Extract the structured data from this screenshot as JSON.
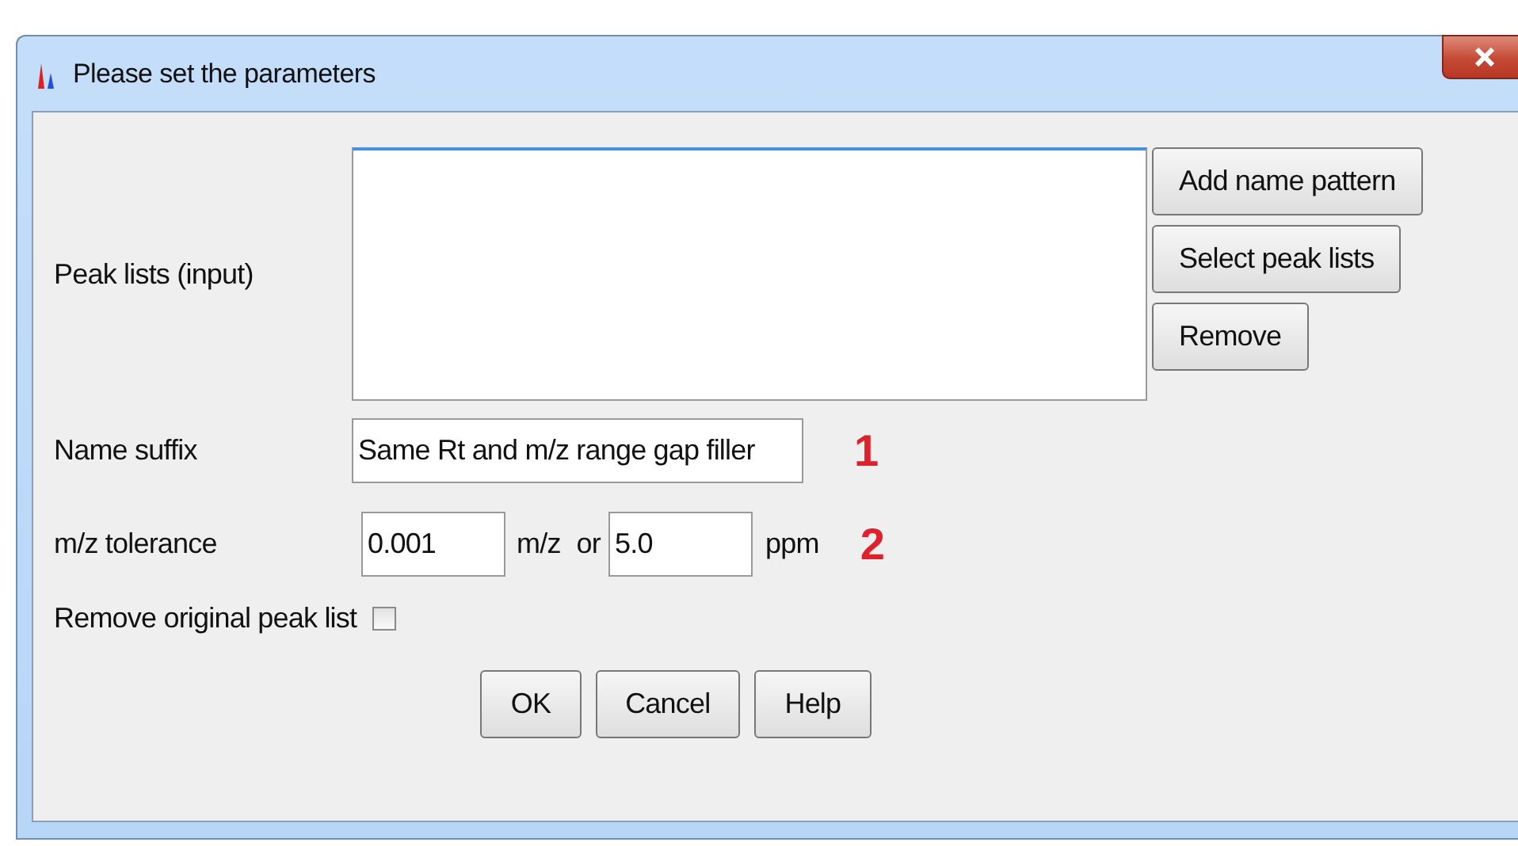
{
  "window": {
    "title": "Please set the parameters"
  },
  "parameters": [
    {
      "kind": "list",
      "label": "Peak lists (input)",
      "buttons": [
        "Add name pattern",
        "Select peak lists",
        "Remove"
      ]
    },
    {
      "kind": "text",
      "label": "Name suffix",
      "value": "Same Rt and m/z range gap filler",
      "annotation": "1"
    },
    {
      "kind": "tolerance",
      "label": "m/z tolerance",
      "mz_value": "0.001",
      "mz_unit": "m/z",
      "joiner": "or",
      "ppm_value": "5.0",
      "ppm_unit": "ppm",
      "annotation": "2"
    },
    {
      "kind": "checkbox",
      "label": "Remove original peak list",
      "checked": false
    }
  ],
  "buttons": [
    "OK",
    "Cancel",
    "Help"
  ]
}
